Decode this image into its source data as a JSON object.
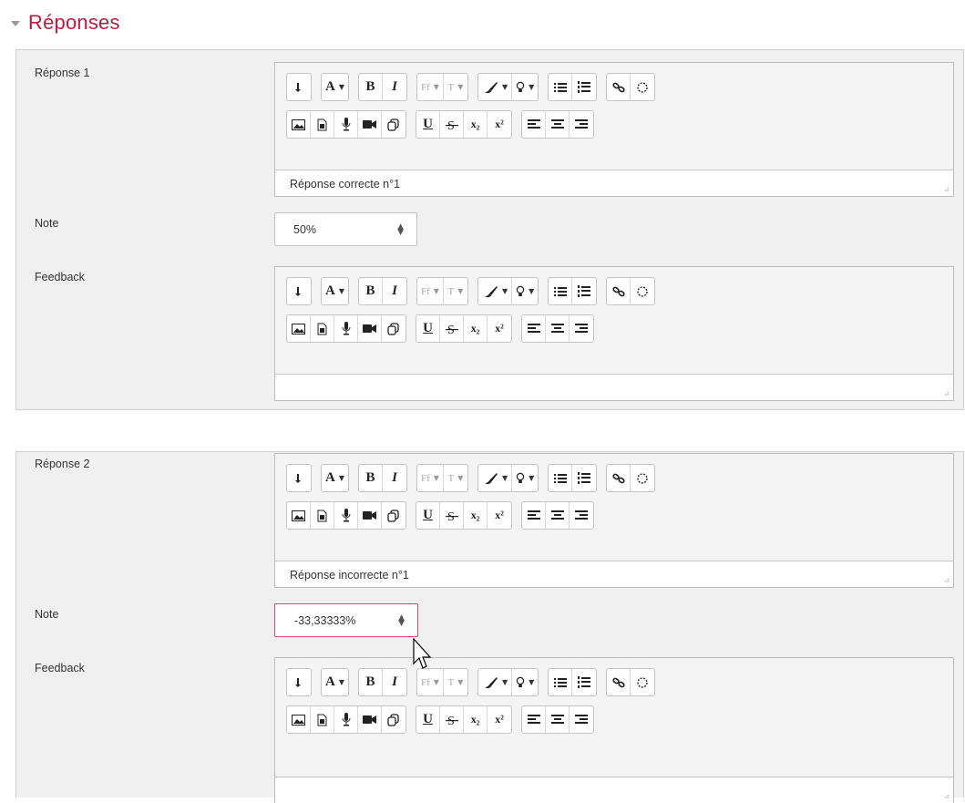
{
  "section": {
    "title": "Réponses"
  },
  "answers": [
    {
      "label": "Réponse 1",
      "answer_text": "Réponse correcte n°1",
      "grade_label": "Note",
      "grade_value": "50%",
      "feedback_label": "Feedback",
      "feedback_text": ""
    },
    {
      "label": "Réponse 2",
      "answer_text": "Réponse incorrecte n°1",
      "grade_label": "Note",
      "grade_value": "-33,33333%",
      "feedback_label": "Feedback",
      "feedback_text": ""
    }
  ],
  "toolbar": {
    "font_color": "A",
    "bold": "B",
    "italic": "I",
    "font_family": "Ff",
    "font_size": "T",
    "underline": "U",
    "subscript": "x₂",
    "superscript": "x²"
  },
  "colors": {
    "accent": "#c8173f",
    "error_border": "#e0457b",
    "panel_bg": "#f0f0f0"
  }
}
